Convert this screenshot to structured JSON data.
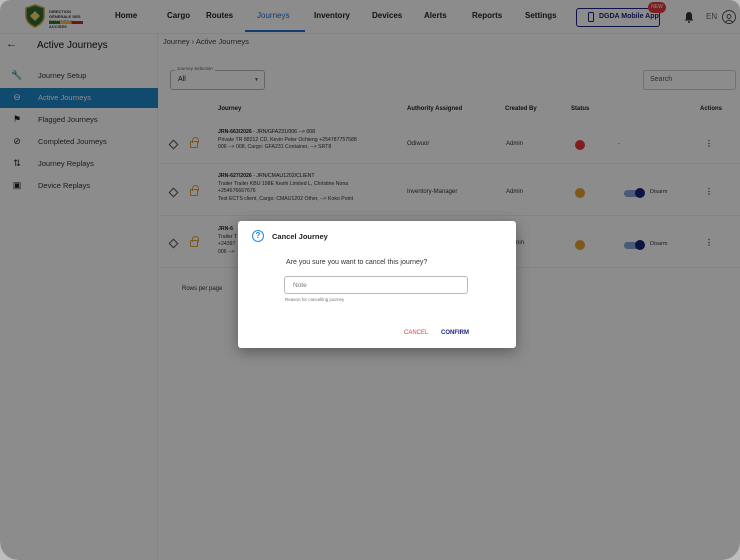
{
  "logo": {
    "text": "DIRECTION GÉNÉRALE DES DOUANES & ACCISES"
  },
  "nav": {
    "home": "Home",
    "items": [
      "Cargo",
      "Routes",
      "Journeys",
      "Inventory",
      "Devices",
      "Alerts",
      "Reports",
      "Settings"
    ],
    "active": "Journeys",
    "mobile_app": "DGDA Mobile App",
    "new_badge": "NEW",
    "lang": "EN"
  },
  "sidebar": {
    "title": "Active Journeys",
    "items": [
      {
        "label": "Journey Setup",
        "icon": "wrench-icon"
      },
      {
        "label": "Active Journeys",
        "icon": "toggle-icon"
      },
      {
        "label": "Flagged Journeys",
        "icon": "flag-icon"
      },
      {
        "label": "Completed Journeys",
        "icon": "check-circle-icon"
      },
      {
        "label": "Journey Replays",
        "icon": "swap-icon"
      },
      {
        "label": "Device Replays",
        "icon": "device-icon"
      }
    ],
    "active_index": 1
  },
  "breadcrumb": "Journey › Active Journeys",
  "filter": {
    "legend": "Journey Selection",
    "value": "All"
  },
  "search": {
    "placeholder": "Search"
  },
  "table": {
    "headers": [
      "Journey",
      "Authority Assigned",
      "Created By",
      "Status",
      "Actions"
    ],
    "rows": [
      {
        "id": "JRN-663/2026",
        "route": " - JRN/GFA231/006 --> 008",
        "line2": "Private TR 88212 CD, Kevin Peter Ochieng +254787757588",
        "line3": "006 --> 008, Cargo: GFA231 Container, --> SRT8",
        "line4": "",
        "authority": "Odiwuor",
        "created_by": "Admin",
        "status_color": "#e53935",
        "arm": "-"
      },
      {
        "id": "JRN-627/2026",
        "route": " - JRN/CMAU1202/CLIENT",
        "line2": "Trailer Trailer KBU 198E Keshi Limited L, Christine Nona",
        "line3": "+254676667676",
        "line4": "Test ECTS client, Cargo: CMAU1202 Other, --> Koko Point",
        "authority": "Inventory-Manager",
        "created_by": "Admin",
        "status_color": "#e5a030",
        "arm": "Disarm"
      },
      {
        "id": "JRN-6",
        "route": "",
        "line2": "Trailer T",
        "line3": "+24397",
        "line4": "006 -->",
        "authority": "",
        "created_by": "nin",
        "status_color": "#e5a030",
        "arm": "Disarm"
      }
    ]
  },
  "pagination": {
    "rows_per_page": "Rows per page"
  },
  "dialog": {
    "title": "Cancel Journey",
    "message": "Are you sure you want to cancel this journey?",
    "note_placeholder": "Note",
    "note_help": "Reason for cancelling journey",
    "cancel": "CANCEL",
    "confirm": "CONFIRM"
  }
}
